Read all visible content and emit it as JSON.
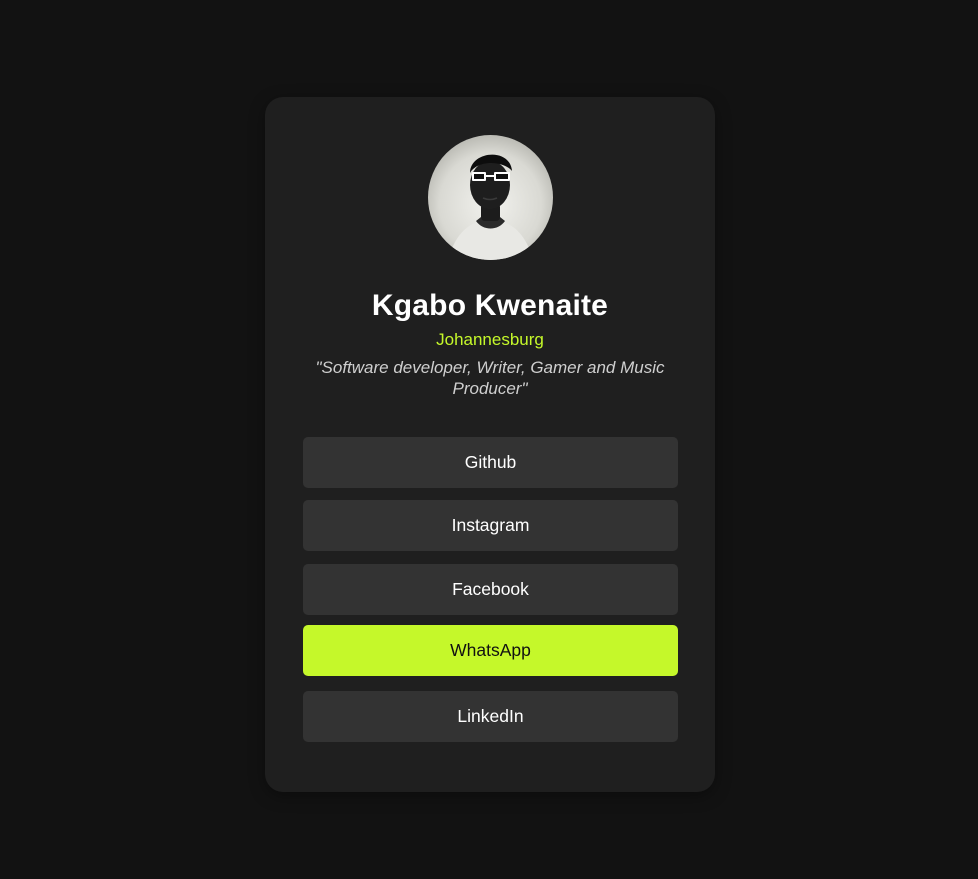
{
  "profile": {
    "name": "Kgabo Kwenaite",
    "location": "Johannesburg",
    "bio": "\"Software developer, Writer, Gamer and Music Producer\""
  },
  "links": [
    {
      "label": "Github"
    },
    {
      "label": "Instagram"
    },
    {
      "label": "Facebook"
    },
    {
      "label": "WhatsApp"
    },
    {
      "label": "LinkedIn"
    }
  ],
  "colors": {
    "background": "#121212",
    "card": "#1f1f1f",
    "accent": "#c5f82a",
    "button": "#333333"
  }
}
